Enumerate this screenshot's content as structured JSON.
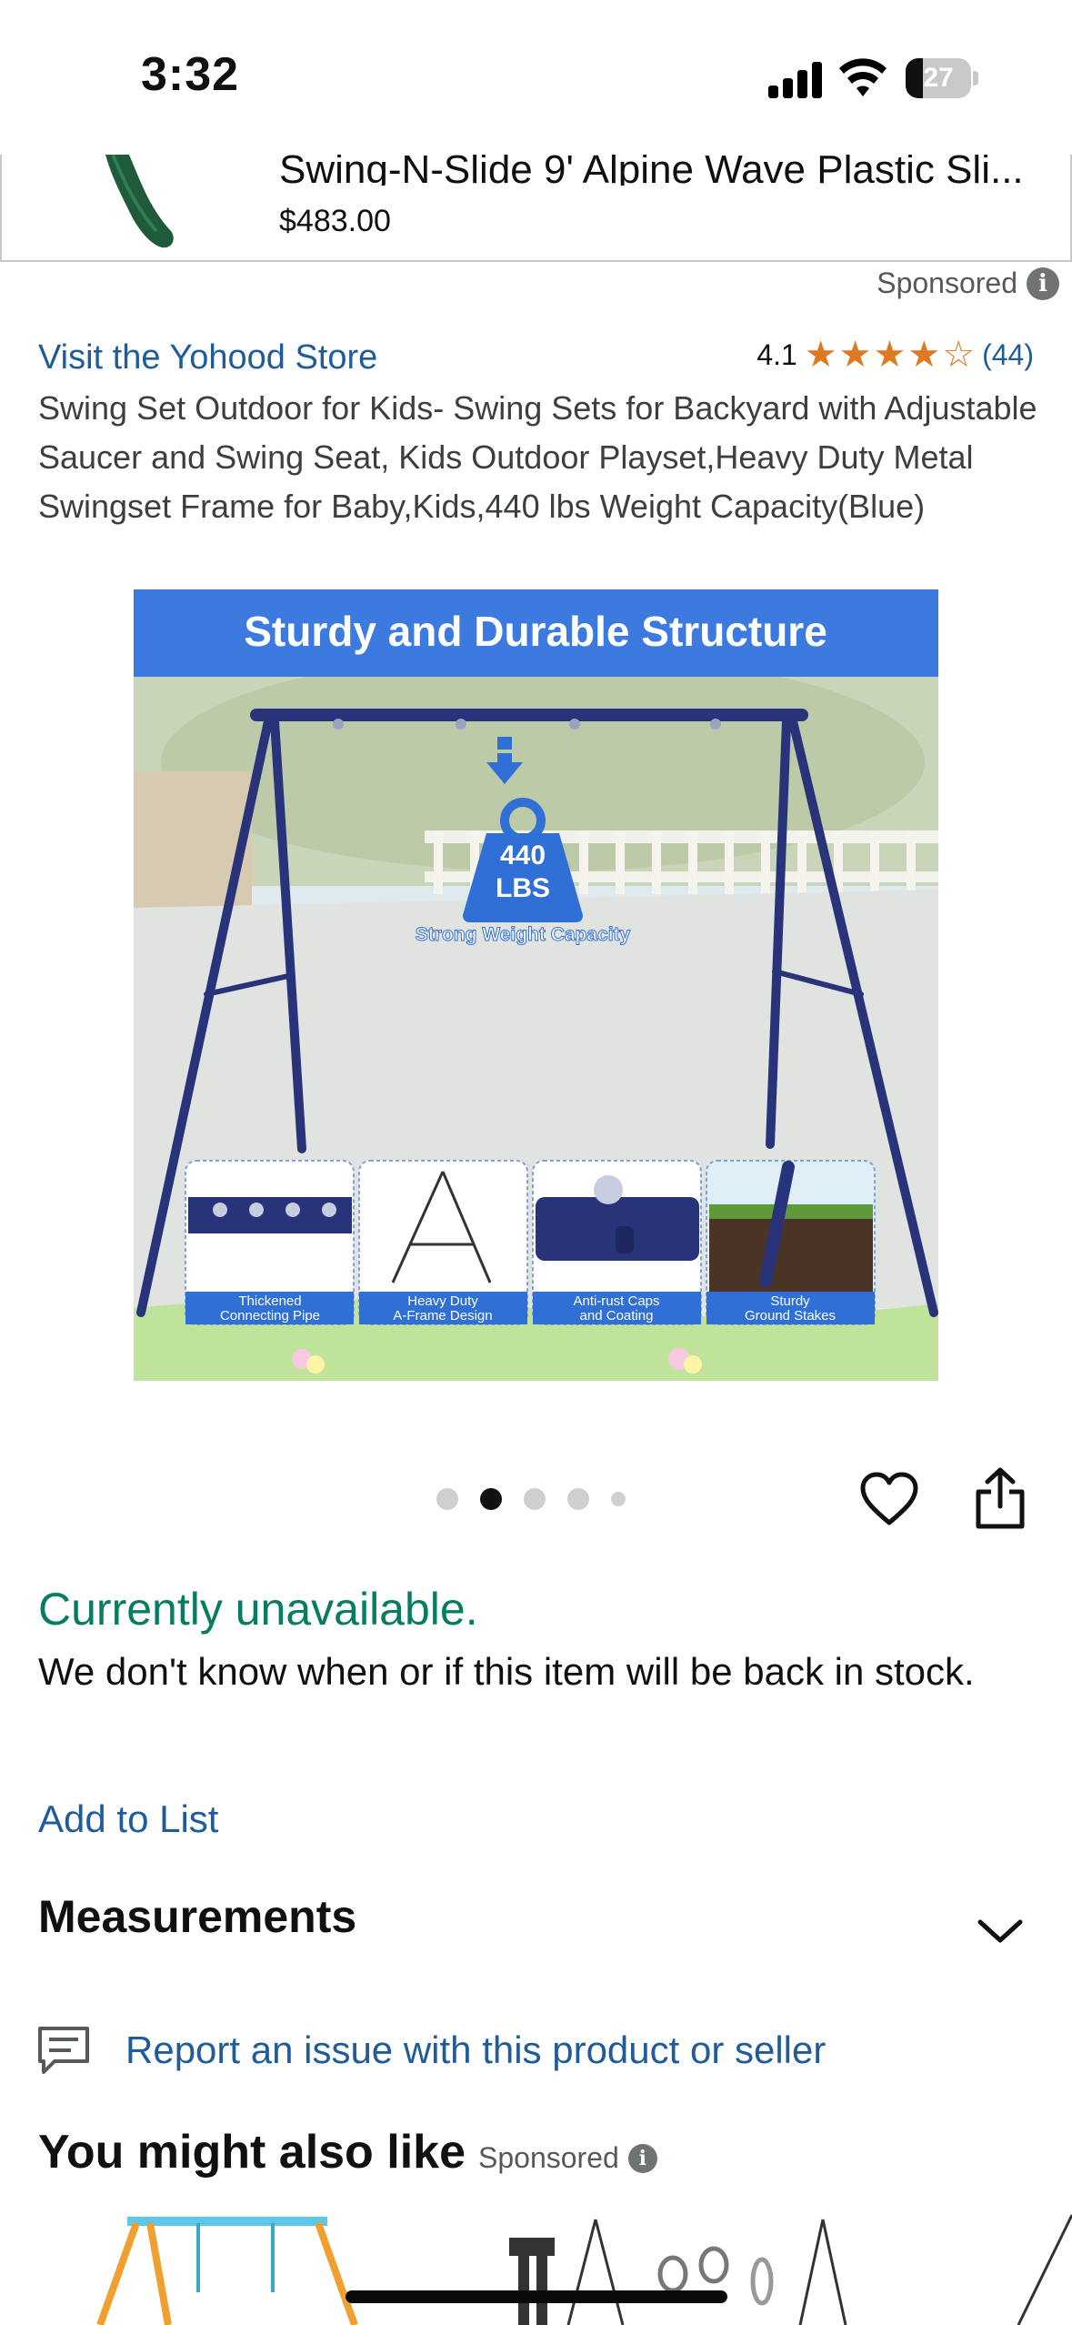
{
  "status_bar": {
    "time": "3:32",
    "battery_level": "27"
  },
  "sponsored_banner": {
    "title": "Swing-N-Slide 9' Alpine Wave Plastic Sli...",
    "price": "$483.00",
    "thumb_color": "#1f5a3a"
  },
  "sponsored_label": "Sponsored",
  "info_glyph": "i",
  "product": {
    "store_link": "Visit the Yohood Store",
    "rating_value": "4.1",
    "stars": {
      "filled": 4,
      "empty": 1
    },
    "rating_count": "(44)",
    "title": "Swing Set Outdoor for Kids- Swing Sets for Backyard with Adjustable Saucer and Swing Seat, Kids Outdoor Playset,Heavy Duty Metal Swingset Frame for Baby,Kids,440 lbs Weight Capacity(Blue)"
  },
  "image": {
    "banner_text": "Sturdy and Durable Structure",
    "weight_line1": "440",
    "weight_line2": "LBS",
    "weight_caption": "Strong Weight Capacity",
    "features": [
      {
        "line1": "Thickened",
        "line2": "Connecting Pipe"
      },
      {
        "line1": "Heavy Duty",
        "line2": "A-Frame Design"
      },
      {
        "line1": "Anti-rust Caps",
        "line2": "and Coating"
      },
      {
        "line1": "Sturdy",
        "line2": "Ground Stakes"
      }
    ],
    "colors": {
      "banner": "#3c7ae0",
      "frame": "#28337a",
      "feature_label": "#2f6fd6"
    }
  },
  "carousel": {
    "count": 5,
    "active_index": 1
  },
  "availability": {
    "status": "Currently unavailable.",
    "detail": "We don't know when or if this item will be back in stock.",
    "color": "#067d62"
  },
  "add_to_list": "Add to List",
  "measurements": {
    "label": "Measurements",
    "icon": "chevron-down-icon"
  },
  "report": {
    "text": "Report an issue with this product or seller",
    "icon": "feedback-icon"
  },
  "recommendations": {
    "title": "You might also like",
    "sponsored": "Sponsored"
  },
  "colors": {
    "link": "#1f5c99",
    "star": "#de7921",
    "text": "#0f1111",
    "secondary": "#565959"
  }
}
